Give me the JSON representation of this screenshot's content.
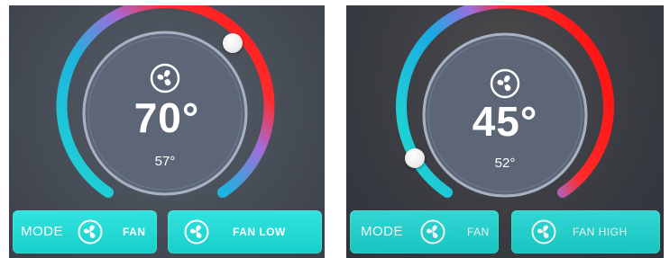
{
  "panels": [
    {
      "set_temp": "70°",
      "current_temp": "57°",
      "mode_label": "MODE",
      "mode_value": "FAN",
      "fan_label": "FAN LOW",
      "slider_level_fraction": 0.73
    },
    {
      "set_temp": "45°",
      "current_temp": "52°",
      "mode_label": "MODE",
      "mode_value": "FAN",
      "fan_label": "FAN HIGH",
      "slider_level_fraction": 0.12
    }
  ],
  "colors": {
    "arc_cool": "#19d3d0",
    "arc_mid": "#b86fd3",
    "arc_warm": "#ff1f1f",
    "button_bg": "#22d8d3",
    "dial_bg": "#5c6677"
  },
  "icons": [
    "fan-icon"
  ]
}
